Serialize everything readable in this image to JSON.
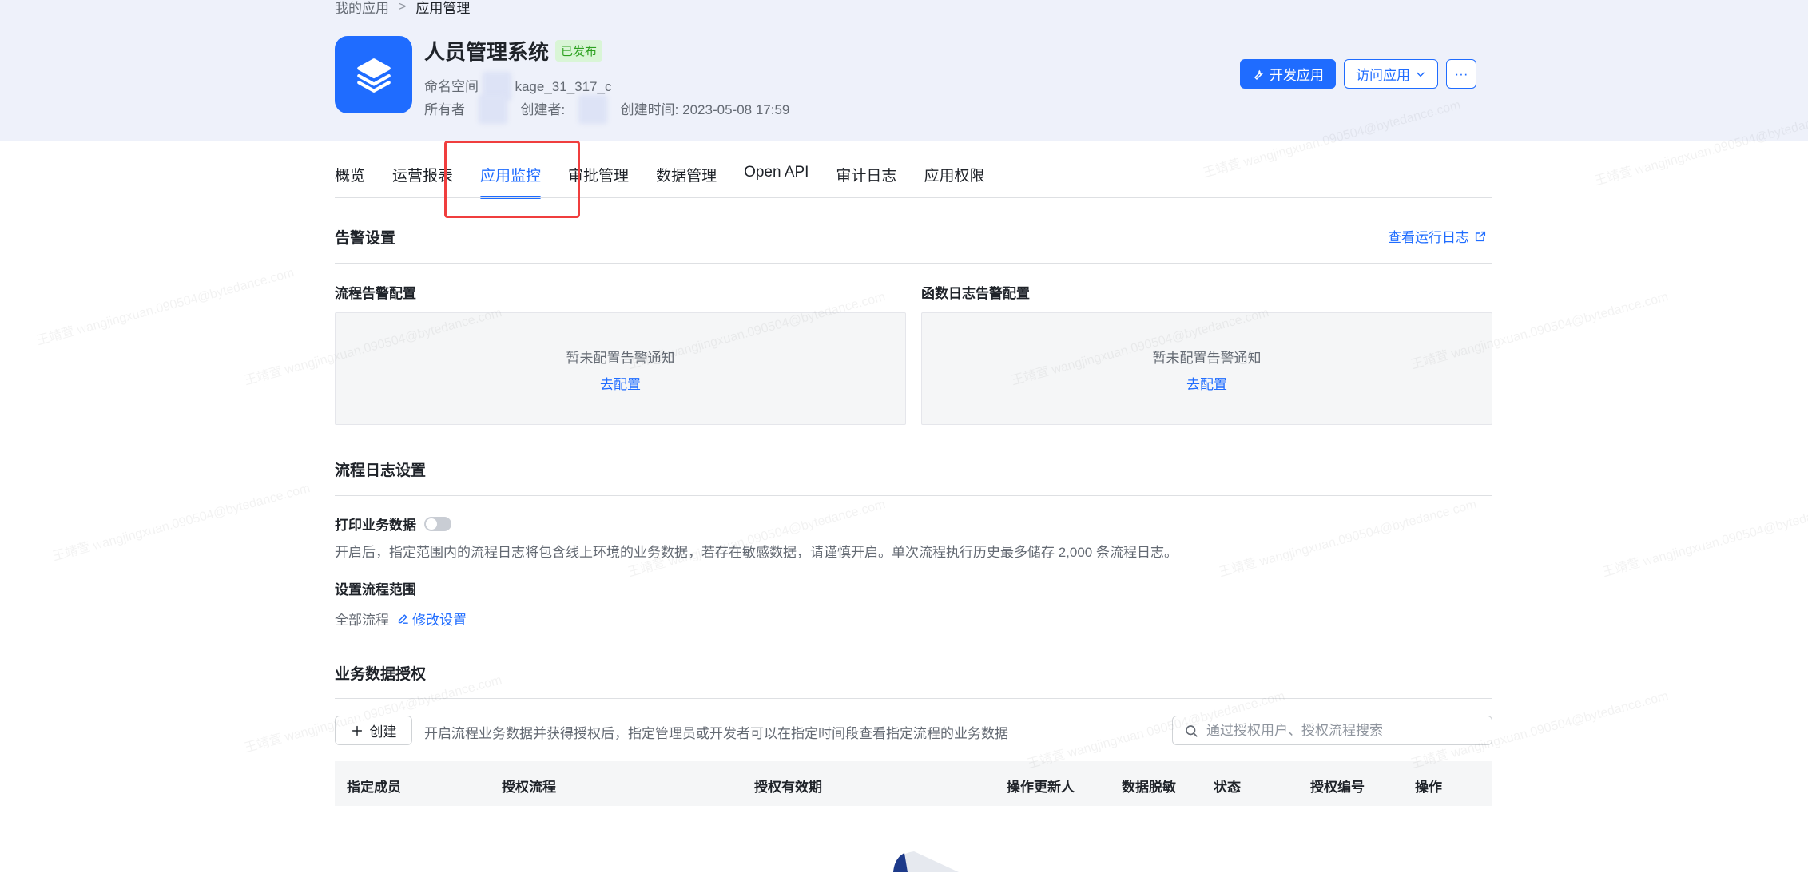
{
  "breadcrumb": {
    "parent": "我的应用",
    "current": "应用管理"
  },
  "app": {
    "name": "人员管理系统",
    "status": "已发布",
    "namespace_label": "命名空间",
    "namespace_value": "kage_31_317_c",
    "owner_label": "所有者",
    "creator_label": "创建者:",
    "created_label": "创建时间:",
    "created_value": "2023-05-08 17:59"
  },
  "actions": {
    "develop": "开发应用",
    "visit": "访问应用",
    "more": "···"
  },
  "tabs": [
    "概览",
    "运营报表",
    "应用监控",
    "审批管理",
    "数据管理",
    "Open API",
    "审计日志",
    "应用权限"
  ],
  "alert": {
    "title": "告警设置",
    "view_log": "查看运行日志",
    "flow_title": "流程告警配置",
    "func_title": "函数日志告警配置",
    "empty_text": "暂未配置告警通知",
    "config_link": "去配置"
  },
  "flow_log": {
    "title": "流程日志设置",
    "toggle_label": "打印业务数据",
    "description": "开启后，指定范围内的流程日志将包含线上环境的业务数据，若存在敏感数据，请谨慎开启。单次流程执行历史最多储存 2,000 条流程日志。",
    "range_title": "设置流程范围",
    "range_value": "全部流程",
    "edit_link": "修改设置"
  },
  "auth": {
    "title": "业务数据授权",
    "create": "创建",
    "description": "开启流程业务数据并获得授权后，指定管理员或开发者可以在指定时间段查看指定流程的业务数据",
    "search_placeholder": "通过授权用户、授权流程搜索",
    "columns": [
      "指定成员",
      "授权流程",
      "授权有效期",
      "操作更新人",
      "数据脱敏",
      "状态",
      "授权编号",
      "操作"
    ]
  },
  "watermark": "王靖萱 wangjingxuan.090504@bytedance.com",
  "colors": {
    "primary": "#1f6cff",
    "highlight": "#f03e3e",
    "success": "#2ea121"
  }
}
